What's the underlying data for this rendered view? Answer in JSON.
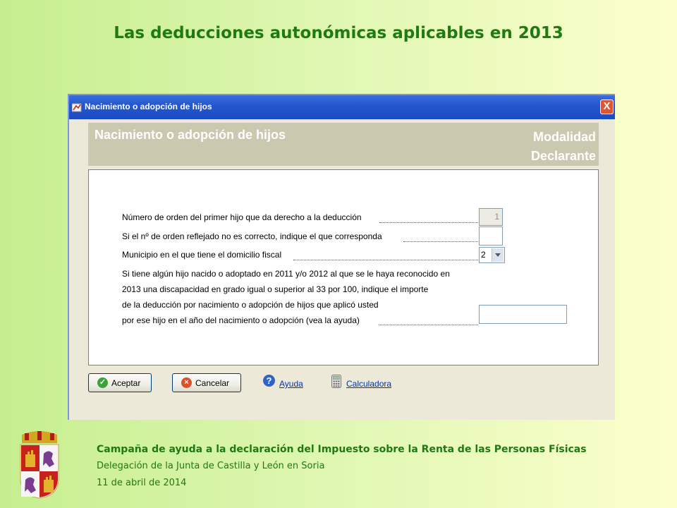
{
  "slide": {
    "title": "Las deducciones autonómicas aplicables en 2013"
  },
  "window": {
    "title": "Nacimiento o adopción de hijos",
    "close_label": "X"
  },
  "form_header": {
    "title": "Nacimiento o adopción de hijos",
    "right_line1": "Modalidad",
    "right_line2": "Declarante"
  },
  "form": {
    "field_orden": {
      "label": "Número de orden del primer hijo que da derecho a la deducción",
      "value": "1"
    },
    "field_orden_correcto": {
      "label": "Si el nº de orden reflejado no es correcto, indique el que corresponda",
      "value": ""
    },
    "field_municipio": {
      "label": "Municipio en el que tiene el domicilio fiscal",
      "value": "2"
    },
    "field_importe": {
      "lines": [
        "Si tiene algún hijo nacido o adoptado en 2011 y/o 2012 al que se le haya reconocido en",
        "2013 una discapacidad en grado igual o superior al 33 por 100, indique el importe",
        "de la deducción por nacimiento o adopción de hijos que aplicó usted",
        "por ese hijo en el año del nacimiento o adopción (vea la ayuda)"
      ],
      "value": ""
    }
  },
  "buttons": {
    "accept": "Aceptar",
    "cancel": "Cancelar",
    "help": "Ayuda",
    "calculator": "Calculadora"
  },
  "footer": {
    "line1": "Campaña de ayuda a la declaración del Impuesto sobre la Renta de las Personas Físicas",
    "line2": "Delegación de la Junta de Castilla y León en Soria",
    "line3": "11 de abril de 2014"
  },
  "colors": {
    "title_green": "#1f7a12",
    "titlebar_blue": "#2457cf",
    "header_gray": "#cac8af",
    "link_blue": "#0033aa"
  },
  "icons": {
    "app": "app-icon",
    "close": "close-icon",
    "accept": "check-icon",
    "cancel": "cancel-icon",
    "help": "help-icon",
    "calculator": "calculator-icon",
    "coat_of_arms": "coat-of-arms-icon"
  }
}
